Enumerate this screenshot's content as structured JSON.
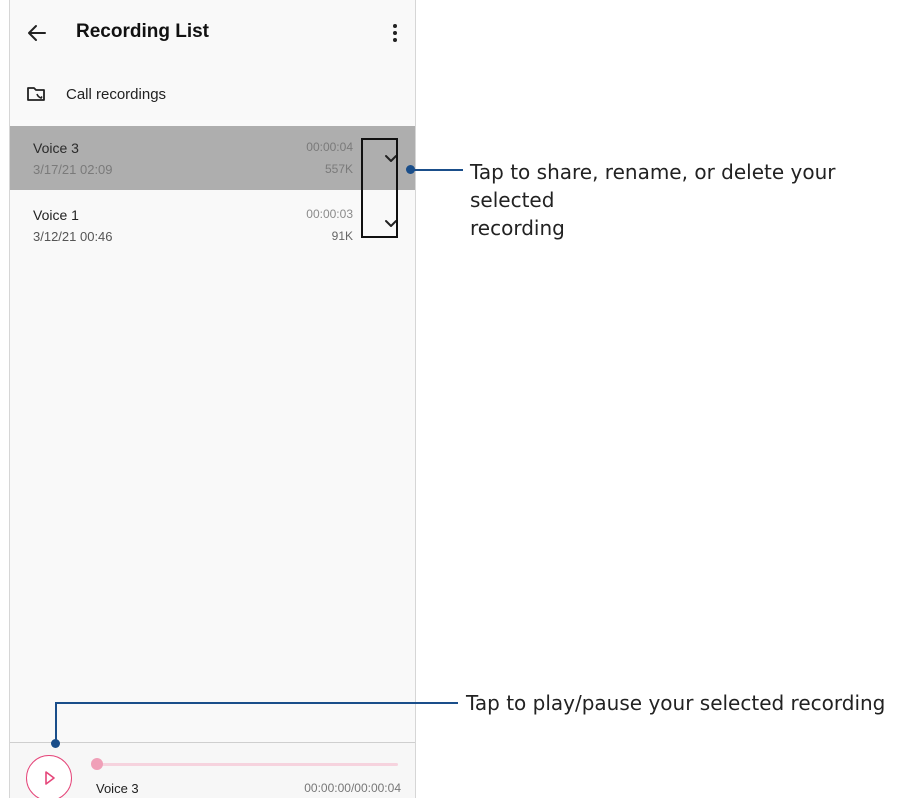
{
  "appbar": {
    "title": "Recording List",
    "back_icon": "arrow-left-icon",
    "more_icon": "more-vert-icon"
  },
  "call_recordings": {
    "label": "Call recordings",
    "icon": "folder-call-icon"
  },
  "recordings": [
    {
      "name": "Voice 3",
      "date": "3/17/21 02:09",
      "duration": "00:00:04",
      "size": "557K",
      "selected": true
    },
    {
      "name": "Voice 1",
      "date": "3/12/21 00:46",
      "duration": "00:00:03",
      "size": "91K",
      "selected": false
    }
  ],
  "player": {
    "name": "Voice 3",
    "time": "00:00:00/00:00:04",
    "progress": 0,
    "accent_color": "#e5467a"
  },
  "callouts": {
    "menu": {
      "text_line1": "Tap to share, rename, or delete your selected",
      "text_line2": "recording"
    },
    "play": {
      "text": "Tap to play/pause your selected recording"
    }
  },
  "colors": {
    "selected_row": "#aeaeae",
    "callout_line": "#1a4e8a"
  }
}
